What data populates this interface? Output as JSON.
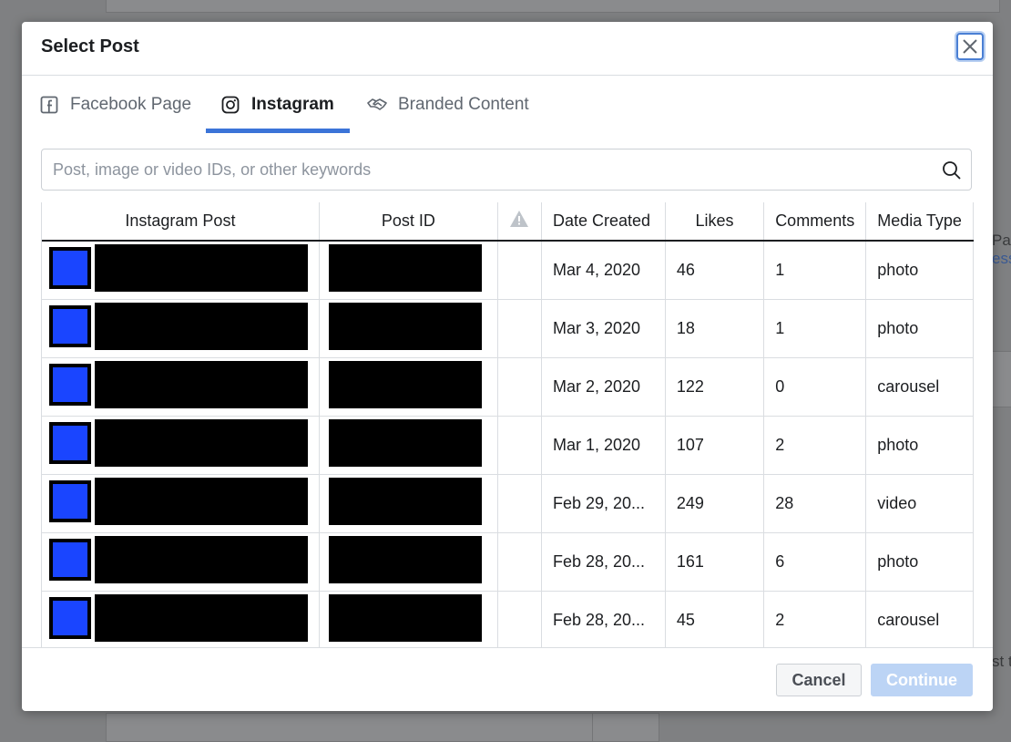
{
  "background": {
    "page_text": "Pag",
    "link_text": "ess",
    "side_text": "st t"
  },
  "modal": {
    "title": "Select Post",
    "tabs": [
      {
        "label": "Facebook Page",
        "icon": "facebook-icon",
        "active": false
      },
      {
        "label": "Instagram",
        "icon": "instagram-icon",
        "active": true
      },
      {
        "label": "Branded Content",
        "icon": "handshake-icon",
        "active": false
      }
    ],
    "search": {
      "placeholder": "Post, image or video IDs, or other keywords",
      "value": ""
    },
    "table": {
      "columns": [
        "Instagram Post",
        "Post ID",
        "",
        "Date Created",
        "Likes",
        "Comments",
        "Media Type"
      ],
      "rows": [
        {
          "date": "Mar 4, 2020",
          "likes": "46",
          "comments": "1",
          "media_type": "photo"
        },
        {
          "date": "Mar 3, 2020",
          "likes": "18",
          "comments": "1",
          "media_type": "photo"
        },
        {
          "date": "Mar 2, 2020",
          "likes": "122",
          "comments": "0",
          "media_type": "carousel"
        },
        {
          "date": "Mar 1, 2020",
          "likes": "107",
          "comments": "2",
          "media_type": "photo"
        },
        {
          "date": "Feb 29, 20...",
          "likes": "249",
          "comments": "28",
          "media_type": "video"
        },
        {
          "date": "Feb 28, 20...",
          "likes": "161",
          "comments": "6",
          "media_type": "photo"
        },
        {
          "date": "Feb 28, 20...",
          "likes": "45",
          "comments": "2",
          "media_type": "carousel"
        }
      ]
    },
    "footer": {
      "cancel_label": "Cancel",
      "continue_label": "Continue"
    }
  },
  "colors": {
    "accent": "#3b74d8",
    "thumbnail": "#1a45ff",
    "continue_disabled": "#bcd4f5"
  }
}
